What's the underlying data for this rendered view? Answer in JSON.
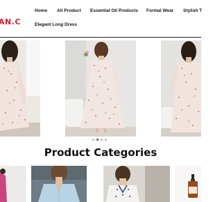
{
  "brand": {
    "logo_text": "AN.C",
    "color": "#d61f2c"
  },
  "nav": {
    "items": [
      {
        "label": "Home"
      },
      {
        "label": "All Product"
      },
      {
        "label": "Essential Oil Products"
      },
      {
        "label": "Formal Wear"
      },
      {
        "label": "Stylish T"
      },
      {
        "label": "Elegant Long Dress"
      }
    ]
  },
  "slider": {
    "slides": [
      {
        "alt": "floral long dress model"
      },
      {
        "alt": "floral long dress model"
      },
      {
        "alt": "floral long dress model"
      }
    ],
    "dot_count": 4,
    "active_dot": 1
  },
  "categories": {
    "title": "Product Categories",
    "items": [
      {
        "icon": "category-image-pink"
      },
      {
        "icon": "category-image-blue-shirt"
      },
      {
        "icon": "category-image-embroidered-blouse"
      },
      {
        "icon": "category-image-essential-oil"
      }
    ]
  }
}
